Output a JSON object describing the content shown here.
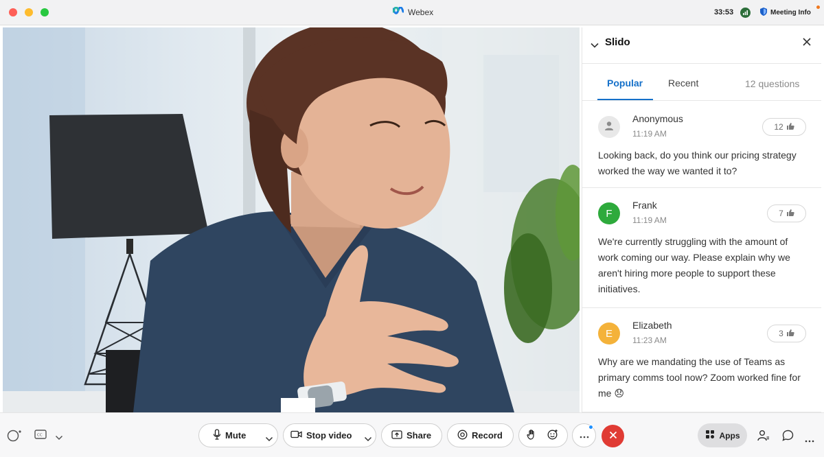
{
  "titlebar": {
    "app_name": "Webex",
    "timer": "33:53",
    "meeting_info": "Meeting Info"
  },
  "panel": {
    "title": "Slido",
    "tabs": [
      {
        "label": "Popular",
        "active": true
      },
      {
        "label": "Recent",
        "active": false
      }
    ],
    "question_count": "12 questions",
    "questions": [
      {
        "author": "Anonymous",
        "time": "11:19 AM",
        "likes": "12",
        "avatar": "person-icon",
        "avatar_color": "#e8e8e8",
        "text": "Looking back, do you think our pricing strategy worked the way we wanted it to?"
      },
      {
        "author": "Frank",
        "time": "11:19 AM",
        "likes": "7",
        "avatar": "F",
        "avatar_color": "#2eaa3c",
        "text": "We're currently struggling with the amount of work coming our way. Please explain why we aren't hiring more people to support these initiatives."
      },
      {
        "author": "Elizabeth",
        "time": "11:23 AM",
        "likes": "3",
        "avatar": "E",
        "avatar_color": "#f4b23a",
        "text": "Why are we mandating the use of Teams as primary comms tool now? Zoom worked fine for me 😞"
      }
    ]
  },
  "controls": {
    "mute_label": "Mute",
    "stop_video_label": "Stop video",
    "share_label": "Share",
    "record_label": "Record",
    "apps_label": "Apps"
  },
  "colors": {
    "accent": "#1570c9",
    "end_call": "#e03b34",
    "slido_tab": "#1570c9"
  }
}
